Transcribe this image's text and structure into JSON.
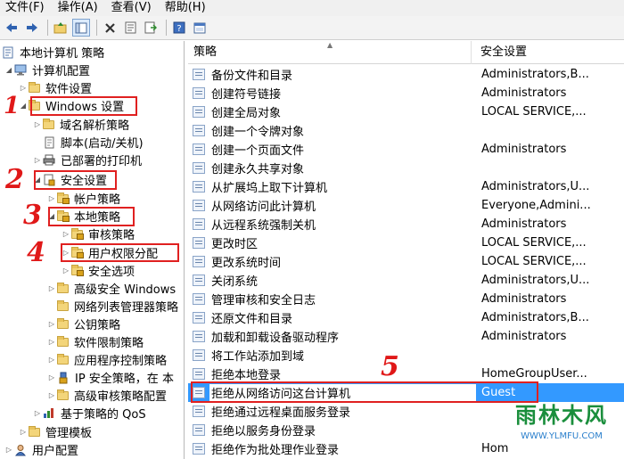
{
  "menu": [
    {
      "label": "文件(F)"
    },
    {
      "label": "操作(A)"
    },
    {
      "label": "查看(V)"
    },
    {
      "label": "帮助(H)"
    }
  ],
  "toolbar": {
    "icons": [
      "back-arrow-icon",
      "forward-arrow-icon",
      "up-folder-icon",
      "show-hide-tree-icon",
      "delete-icon",
      "properties-icon",
      "export-list-icon",
      "help-icon",
      "console-icon"
    ]
  },
  "tree": {
    "items": [
      {
        "label": "本地计算机 策略"
      },
      {
        "label": "计算机配置"
      },
      {
        "label": "软件设置"
      },
      {
        "label": "Windows 设置"
      },
      {
        "label": "域名解析策略"
      },
      {
        "label": "脚本(启动/关机)"
      },
      {
        "label": "已部署的打印机"
      },
      {
        "label": "安全设置"
      },
      {
        "label": "帐户策略"
      },
      {
        "label": "本地策略"
      },
      {
        "label": "审核策略"
      },
      {
        "label": "用户权限分配"
      },
      {
        "label": "安全选项"
      },
      {
        "label": "高级安全 Windows"
      },
      {
        "label": "网络列表管理器策略"
      },
      {
        "label": "公钥策略"
      },
      {
        "label": "软件限制策略"
      },
      {
        "label": "应用程序控制策略"
      },
      {
        "label": "IP 安全策略，在 本"
      },
      {
        "label": "高级审核策略配置"
      },
      {
        "label": "基于策略的 QoS"
      },
      {
        "label": "管理模板"
      },
      {
        "label": "用户配置"
      }
    ]
  },
  "annotations": [
    "1",
    "2",
    "3",
    "4",
    "5"
  ],
  "list": {
    "columns": {
      "policy": "策略",
      "setting": "安全设置"
    },
    "rows": [
      {
        "policy": "备份文件和目录",
        "setting": "Administrators,B..."
      },
      {
        "policy": "创建符号链接",
        "setting": "Administrators"
      },
      {
        "policy": "创建全局对象",
        "setting": "LOCAL SERVICE,..."
      },
      {
        "policy": "创建一个令牌对象",
        "setting": ""
      },
      {
        "policy": "创建一个页面文件",
        "setting": "Administrators"
      },
      {
        "policy": "创建永久共享对象",
        "setting": ""
      },
      {
        "policy": "从扩展坞上取下计算机",
        "setting": "Administrators,U..."
      },
      {
        "policy": "从网络访问此计算机",
        "setting": "Everyone,Admini..."
      },
      {
        "policy": "从远程系统强制关机",
        "setting": "Administrators"
      },
      {
        "policy": "更改时区",
        "setting": "LOCAL SERVICE,..."
      },
      {
        "policy": "更改系统时间",
        "setting": "LOCAL SERVICE,..."
      },
      {
        "policy": "关闭系统",
        "setting": "Administrators,U..."
      },
      {
        "policy": "管理审核和安全日志",
        "setting": "Administrators"
      },
      {
        "policy": "还原文件和目录",
        "setting": "Administrators,B..."
      },
      {
        "policy": "加载和卸载设备驱动程序",
        "setting": "Administrators"
      },
      {
        "policy": "将工作站添加到域",
        "setting": ""
      },
      {
        "policy": "拒绝本地登录",
        "setting": "HomeGroupUser..."
      },
      {
        "policy": "拒绝从网络访问这台计算机",
        "setting": "Guest"
      },
      {
        "policy": "拒绝通过远程桌面服务登录",
        "setting": ""
      },
      {
        "policy": "拒绝以服务身份登录",
        "setting": ""
      },
      {
        "policy": "拒绝作为批处理作业登录",
        "setting": "Hom"
      }
    ]
  },
  "watermark": {
    "title": "雨林木风",
    "url": "WWW.YLMFU.COM"
  },
  "colors": {
    "selection": "#3399ff",
    "annotation": "#e02020",
    "watermark": "#1a8e3c"
  }
}
